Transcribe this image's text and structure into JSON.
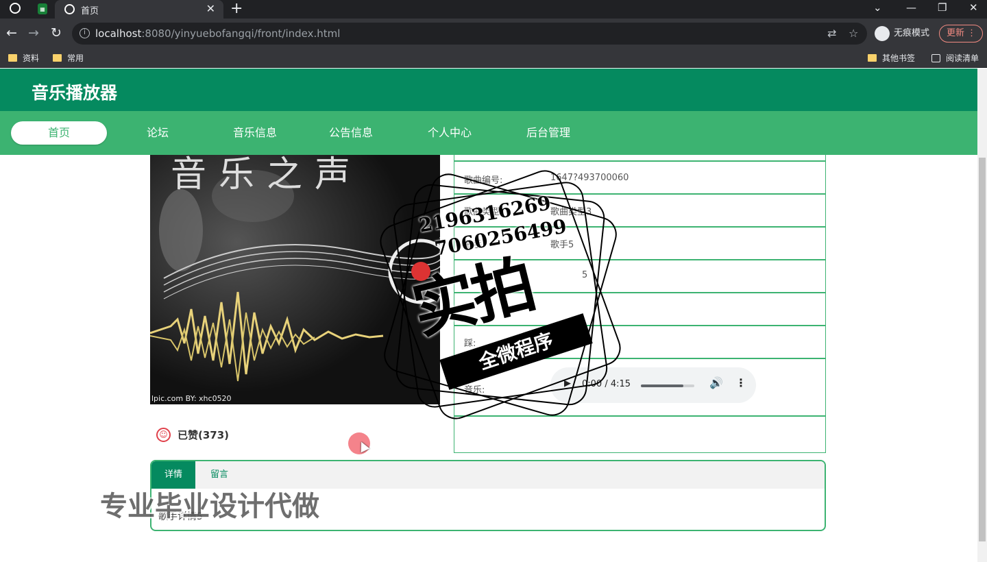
{
  "browser": {
    "tab_title": "首页",
    "url_host": "localhost",
    "url_rest": ":8080/yinyuebofangqi/front/index.html",
    "incognito_label": "无痕模式",
    "update_label": "更新",
    "bookmarks": [
      "资料",
      "常用"
    ],
    "bookmarks_right": [
      "其他书签",
      "阅读清单"
    ]
  },
  "site": {
    "title": "音乐播放器",
    "nav": [
      "首页",
      "论坛",
      "音乐信息",
      "公告信息",
      "个人中心",
      "后台管理"
    ]
  },
  "cover": {
    "headline": "音乐之声",
    "credit": "lpic.com    BY: xhc0520"
  },
  "details": {
    "rows": [
      {
        "label": "歌曲编号:",
        "value": "1647?493700060"
      },
      {
        "label": "歌曲类型:",
        "value": "歌曲类型3"
      },
      {
        "label": "歌手:",
        "value": "歌手5"
      },
      {
        "label": "",
        "value": "5"
      },
      {
        "label": "",
        "value": ""
      },
      {
        "label": "踩:",
        "value": ""
      },
      {
        "label": "音乐:",
        "value": ""
      }
    ],
    "audio": {
      "current": "0:00",
      "duration": "4:15",
      "volume_level": 0.8
    }
  },
  "like": {
    "label": "已赞(373)"
  },
  "tabs": {
    "items": [
      "详情",
      "留言"
    ],
    "content": "歌手详情5"
  },
  "watermark": {
    "phone1": "2196316269",
    "phone2": "7060256499",
    "big": "实拍",
    "ribbon": "全微程序",
    "bottom": "专业毕业设计代做"
  }
}
